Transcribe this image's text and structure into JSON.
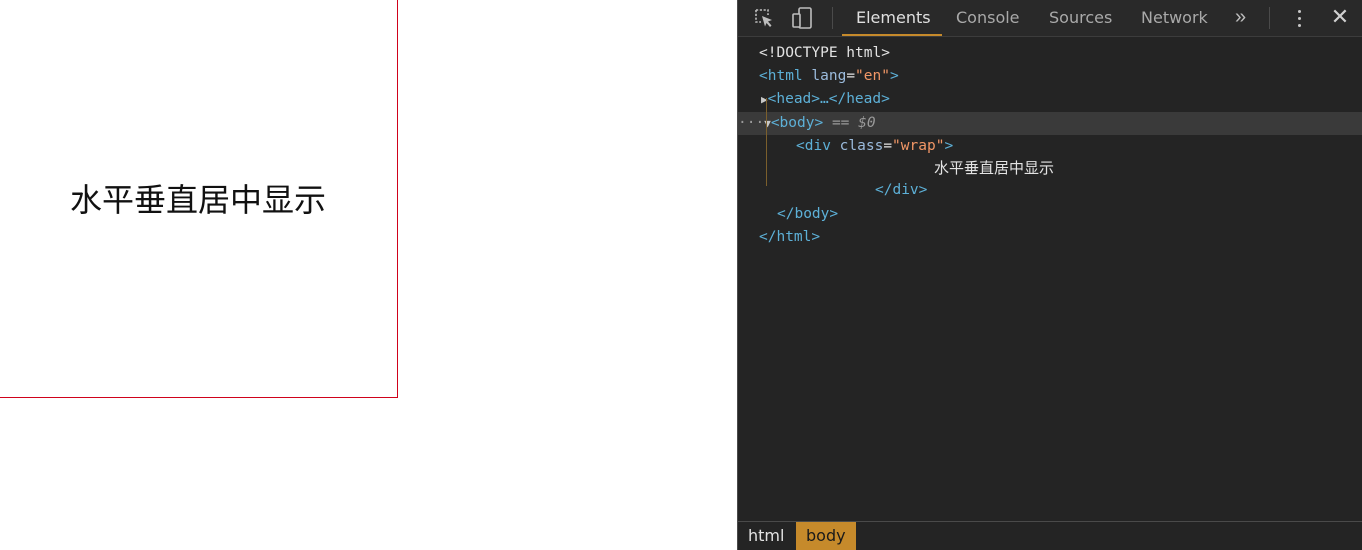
{
  "page": {
    "wrap_text": "水平垂直居中显示"
  },
  "devtools": {
    "tabs": [
      {
        "label": "Elements",
        "active": true
      },
      {
        "label": "Console",
        "active": false
      },
      {
        "label": "Sources",
        "active": false
      },
      {
        "label": "Network",
        "active": false
      }
    ],
    "more_tabs_symbol": "»",
    "close_symbol": "✕",
    "icons": [
      "inspect-element-icon",
      "device-toolbar-icon",
      "more-tabs-icon",
      "kebab-menu-icon",
      "close-icon"
    ],
    "accent_color": "#c68a2b",
    "dom_tree": {
      "doctype": "<!DOCTYPE html>",
      "html_open_tag": "<html",
      "html_attr_name": "lang",
      "html_attr_value": "\"en\"",
      "html_open_end": ">",
      "head_collapsed": "<head>…</head>",
      "body_open": "<body>",
      "body_selected_marker": "== $0",
      "div_open_tag": "<div",
      "div_attr_name": "class",
      "div_attr_value": "\"wrap\"",
      "div_open_end": ">",
      "div_text": "水平垂直居中显示",
      "div_close": "</div>",
      "body_close": "</body>",
      "html_close": "</html>"
    },
    "breadcrumbs": [
      {
        "label": "html",
        "active": false
      },
      {
        "label": "body",
        "active": true
      }
    ]
  }
}
